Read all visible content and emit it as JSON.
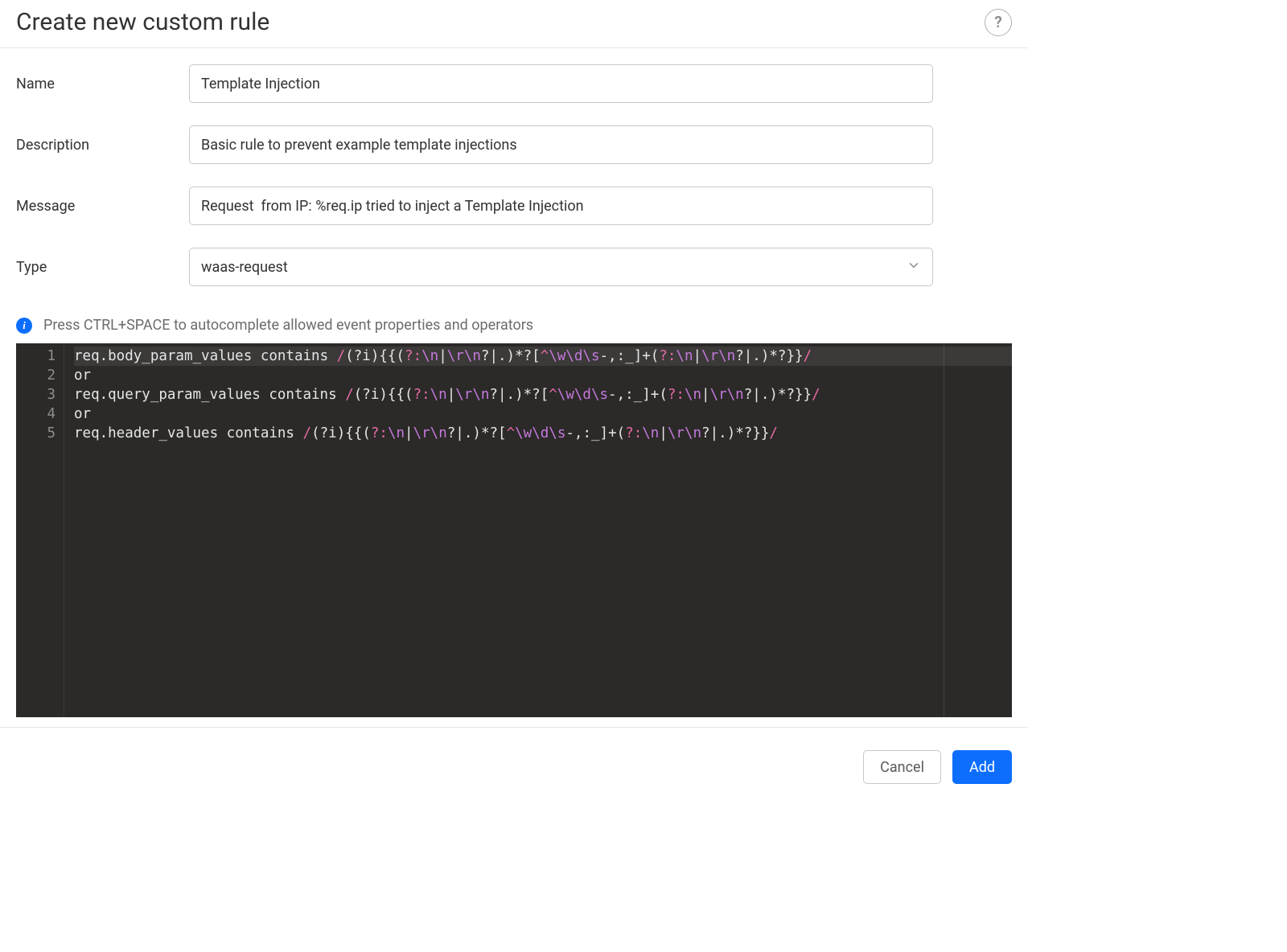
{
  "header": {
    "title": "Create new custom rule"
  },
  "form": {
    "name_label": "Name",
    "name_value": "Template Injection",
    "description_label": "Description",
    "description_value": "Basic rule to prevent example template injections",
    "message_label": "Message",
    "message_value": "Request  from IP: %req.ip tried to inject a Template Injection",
    "type_label": "Type",
    "type_value": "waas-request"
  },
  "hint": {
    "text": "Press CTRL+SPACE to autocomplete allowed event properties and operators"
  },
  "editor": {
    "line_numbers": [
      "1",
      "2",
      "3",
      "4",
      "5"
    ],
    "lines": [
      {
        "prop": "req.body_param_values",
        "kw": "contains",
        "regex": "/(?i){{(?:\\n|\\r\\n?|.)*?[^\\w\\d\\s-,:_]+(?:\\n|\\r\\n?|.)*?}}/",
        "active": true
      },
      {
        "plain": "or"
      },
      {
        "prop": "req.query_param_values",
        "kw": "contains",
        "regex": "/(?i){{(?:\\n|\\r\\n?|.)*?[^\\w\\d\\s-,:_]+(?:\\n|\\r\\n?|.)*?}}/"
      },
      {
        "plain": "or"
      },
      {
        "prop": "req.header_values",
        "kw": "contains",
        "regex": "/(?i){{(?:\\n|\\r\\n?|.)*?[^\\w\\d\\s-,:_]+(?:\\n|\\r\\n?|.)*?}}/"
      }
    ]
  },
  "footer": {
    "cancel_label": "Cancel",
    "add_label": "Add"
  }
}
